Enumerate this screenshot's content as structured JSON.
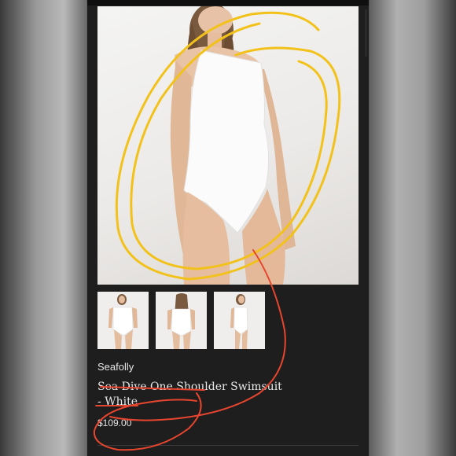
{
  "product": {
    "brand": "Seafolly",
    "title": "Sea Dive One Shoulder Swimsuit - White",
    "price": "$109.00"
  },
  "gallery": {
    "thumbnail_count": 3
  },
  "colors": {
    "highlight_yellow": "#f2c21b",
    "annotation_red": "#e8452f",
    "panel_background": "#1e1e1e"
  }
}
